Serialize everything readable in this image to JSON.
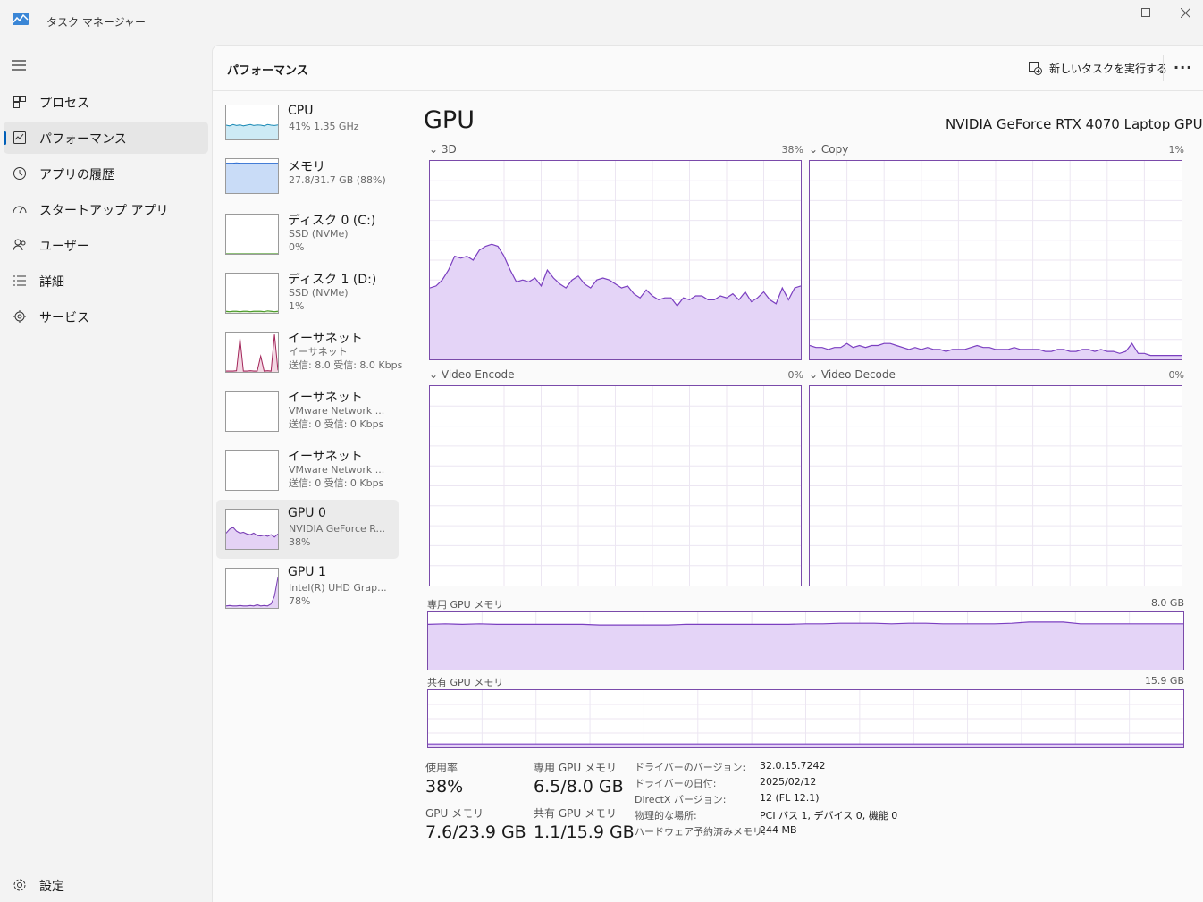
{
  "window": {
    "title": "タスク マネージャー"
  },
  "nav": {
    "items": [
      {
        "label": "プロセス",
        "icon": "processes-icon"
      },
      {
        "label": "パフォーマンス",
        "icon": "performance-icon",
        "active": true
      },
      {
        "label": "アプリの履歴",
        "icon": "history-icon"
      },
      {
        "label": "スタートアップ アプリ",
        "icon": "startup-icon"
      },
      {
        "label": "ユーザー",
        "icon": "users-icon"
      },
      {
        "label": "詳細",
        "icon": "details-icon"
      },
      {
        "label": "サービス",
        "icon": "services-icon"
      }
    ],
    "settings_label": "設定"
  },
  "header": {
    "title": "パフォーマンス",
    "run_task_label": "新しいタスクを実行する"
  },
  "devices": [
    {
      "name": "CPU",
      "sub1": "41%  1.35 GHz",
      "sub2": "",
      "color": "#1a8ab5",
      "fill": "#cdeaf5"
    },
    {
      "name": "メモリ",
      "sub1": "27.8/31.7 GB (88%)",
      "sub2": "",
      "color": "#2a6bd1",
      "fill": "#c9dcf7"
    },
    {
      "name": "ディスク 0 (C:)",
      "sub1": "SSD (NVMe)",
      "sub2": "0%",
      "color": "#4c9a2a",
      "fill": "#e2f1d9"
    },
    {
      "name": "ディスク 1 (D:)",
      "sub1": "SSD (NVMe)",
      "sub2": "1%",
      "color": "#4c9a2a",
      "fill": "#e2f1d9"
    },
    {
      "name": "イーサネット",
      "sub1": "イーサネット",
      "sub2": "送信: 8.0 受信: 8.0 Kbps",
      "color": "#a3265a",
      "fill": "#f3d9e4"
    },
    {
      "name": "イーサネット",
      "sub1": "VMware Network ...",
      "sub2": "送信: 0 受信: 0 Kbps",
      "color": "#a3265a",
      "fill": "#f3d9e4"
    },
    {
      "name": "イーサネット",
      "sub1": "VMware Network ...",
      "sub2": "送信: 0 受信: 0 Kbps",
      "color": "#a3265a",
      "fill": "#f3d9e4"
    },
    {
      "name": "GPU 0",
      "sub1": "NVIDIA GeForce R...",
      "sub2": "38%",
      "color": "#7a3fb5",
      "fill": "#e4d2f5",
      "active": true
    },
    {
      "name": "GPU 1",
      "sub1": "Intel(R) UHD Grap...",
      "sub2": "78%",
      "color": "#7a3fb5",
      "fill": "#e4d2f5"
    }
  ],
  "gpu": {
    "title": "GPU",
    "model": "NVIDIA GeForce RTX 4070 Laptop GPU",
    "engines": [
      {
        "label": "3D",
        "percent": "38%",
        "values": [
          36,
          37,
          40,
          45,
          52,
          51,
          52,
          50,
          55,
          57,
          58,
          57,
          52,
          45,
          39,
          40,
          39,
          41,
          37,
          45,
          41,
          38,
          36,
          40,
          42,
          38,
          36,
          40,
          41,
          40,
          38,
          36,
          37,
          33,
          31,
          35,
          32,
          30,
          31,
          31,
          27,
          31,
          30,
          32,
          32,
          30,
          30,
          32,
          31,
          33,
          30,
          34,
          29,
          31,
          34,
          30,
          28,
          36,
          30,
          36,
          37
        ]
      },
      {
        "label": "Copy",
        "percent": "1%",
        "values": [
          7,
          6,
          6,
          5,
          6,
          6,
          8,
          6,
          7,
          6,
          7,
          7,
          8,
          8,
          7,
          6,
          5,
          6,
          5,
          6,
          5,
          5,
          4,
          5,
          5,
          5,
          6,
          7,
          6,
          6,
          5,
          5,
          5,
          6,
          5,
          5,
          5,
          5,
          4,
          4,
          5,
          5,
          4,
          4,
          5,
          5,
          4,
          5,
          4,
          4,
          3,
          4,
          8,
          3,
          3,
          2,
          2,
          2,
          2,
          2,
          2
        ]
      },
      {
        "label": "Video Encode",
        "percent": "0%",
        "values": []
      },
      {
        "label": "Video Decode",
        "percent": "0%",
        "values": []
      }
    ],
    "dedicated_label": "専用 GPU メモリ",
    "dedicated_max": "8.0 GB",
    "dedicated_values": [
      79,
      80,
      79,
      80,
      79,
      79,
      79,
      79,
      79,
      79,
      78,
      78,
      78,
      78,
      78,
      79,
      79,
      79,
      79,
      79,
      79,
      79,
      80,
      80,
      81,
      81,
      81,
      80,
      81,
      81,
      80,
      80,
      80,
      80,
      81,
      83,
      83,
      83,
      80,
      80,
      80,
      80,
      80,
      80,
      80
    ],
    "shared_label": "共有 GPU メモリ",
    "shared_max": "15.9 GB",
    "shared_values": [
      6,
      6,
      6,
      6,
      6,
      6,
      6,
      6,
      6,
      6,
      6,
      6,
      6,
      6,
      6,
      6,
      6,
      6,
      6,
      6,
      6,
      6,
      6,
      6,
      6,
      6,
      6,
      6,
      6,
      6,
      6,
      6,
      6,
      6,
      6,
      6,
      6,
      6,
      6,
      6,
      6,
      6,
      6,
      6,
      6
    ],
    "stats": {
      "usage_label": "使用率",
      "usage_value": "38%",
      "dedicated_label": "専用 GPU メモリ",
      "dedicated_value": "6.5/8.0 GB",
      "gpu_mem_label": "GPU メモリ",
      "gpu_mem_value": "7.6/23.9 GB",
      "shared_label": "共有 GPU メモリ",
      "shared_value": "1.1/15.9 GB"
    },
    "info": [
      {
        "key": "ドライバーのバージョン:",
        "value": "32.0.15.7242"
      },
      {
        "key": "ドライバーの日付:",
        "value": "2025/02/12"
      },
      {
        "key": "DirectX バージョン:",
        "value": "12 (FL 12.1)"
      },
      {
        "key": "物理的な場所:",
        "value": "PCI バス 1, デバイス 0, 機能 0"
      },
      {
        "key": "ハードウェア予約済みメモリ:",
        "value": "244 MB"
      }
    ]
  },
  "thumb_data": {
    "CPU": [
      42,
      40,
      44,
      41,
      43,
      40,
      42,
      44,
      41,
      43,
      42,
      40,
      44,
      42,
      41,
      43
    ],
    "メモリ": [
      88,
      88,
      88,
      89,
      88,
      88,
      88,
      88,
      88,
      88,
      88,
      88,
      88,
      88,
      88,
      88
    ],
    "disk0": [
      0,
      0,
      0,
      0,
      0,
      0,
      0,
      0,
      0,
      0,
      0,
      0,
      0,
      0,
      0,
      0
    ],
    "disk1": [
      4,
      3,
      4,
      4,
      3,
      4,
      4,
      3,
      4,
      4,
      4,
      3,
      5,
      4,
      3,
      4
    ],
    "eth0": [
      2,
      2,
      2,
      3,
      85,
      2,
      2,
      3,
      2,
      2,
      40,
      2,
      3,
      2,
      95,
      4
    ],
    "gpu0": [
      40,
      50,
      55,
      45,
      40,
      42,
      38,
      36,
      40,
      34,
      33,
      35,
      32,
      36,
      30,
      38
    ],
    "gpu1": [
      5,
      6,
      5,
      5,
      6,
      5,
      5,
      6,
      5,
      8,
      5,
      6,
      5,
      10,
      30,
      78
    ]
  }
}
